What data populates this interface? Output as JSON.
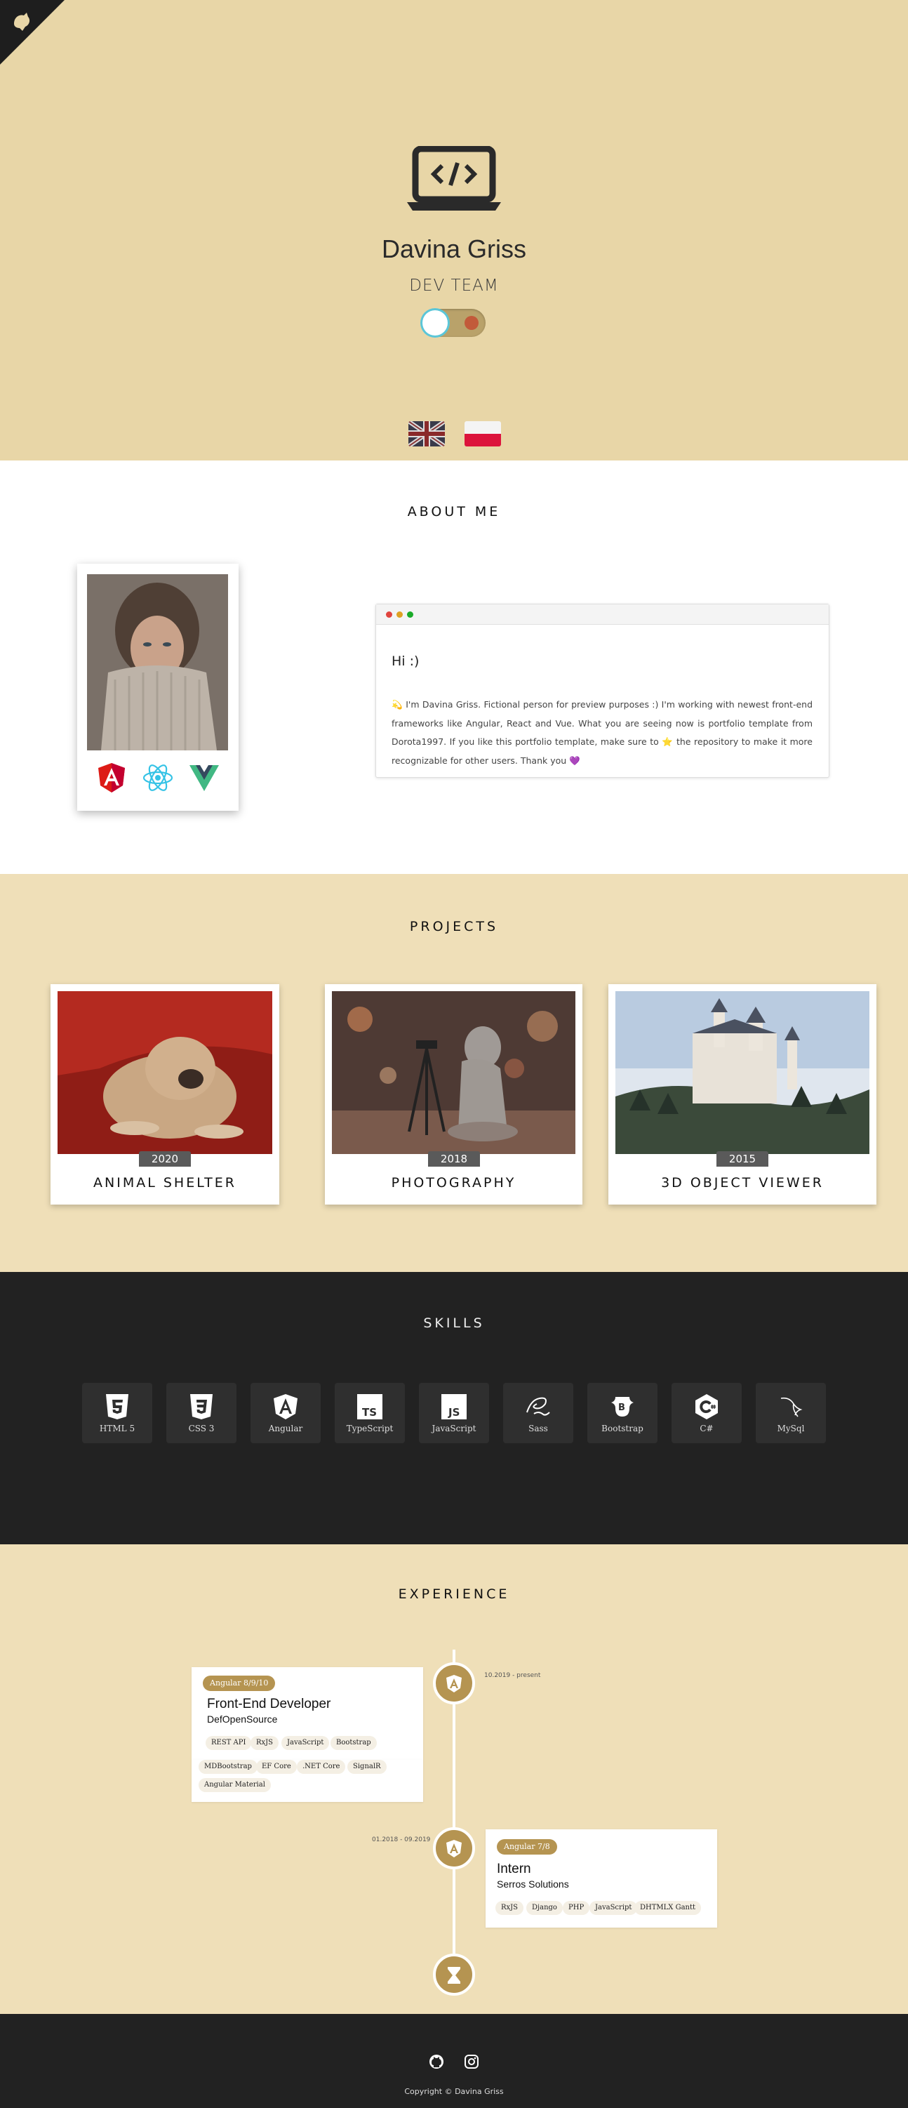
{
  "header": {
    "name": "Davina Griss",
    "role": "DEV TEAM",
    "theme_toggle": "day-night-toggle",
    "languages": [
      {
        "code": "en",
        "icon": "uk-flag-icon"
      },
      {
        "code": "pl",
        "icon": "poland-flag-icon"
      }
    ],
    "colors": {
      "background": "#e8d6a7",
      "accent": "#b59451"
    }
  },
  "about": {
    "title": "ABOUT ME",
    "tech_icons": [
      "angular-icon",
      "react-icon",
      "vue-icon"
    ],
    "greeting": "Hi :)",
    "text_emoji_start": "💫",
    "text_part1": "I'm Davina Griss. Fictional person for preview purposes :) I'm working with newest front-end frameworks like Angular, React and Vue. What you are seeing now is portfolio template from Dorota1997. If you like this portfolio template, make sure to",
    "text_star": "⭐",
    "text_part2": "the repository to make it more recognizable for other users. Thank you",
    "text_heart": "💜"
  },
  "projects": {
    "title": "PROJECTS",
    "items": [
      {
        "name": "ANIMAL SHELTER",
        "year": "2020"
      },
      {
        "name": "PHOTOGRAPHY",
        "year": "2018"
      },
      {
        "name": "3D OBJECT VIEWER",
        "year": "2015"
      }
    ]
  },
  "skills": {
    "title": "SKILLS",
    "items": [
      {
        "label": "HTML 5",
        "icon": "html5-icon"
      },
      {
        "label": "CSS 3",
        "icon": "css3-icon"
      },
      {
        "label": "Angular",
        "icon": "angular-icon"
      },
      {
        "label": "TypeScript",
        "icon": "typescript-icon"
      },
      {
        "label": "JavaScript",
        "icon": "javascript-icon"
      },
      {
        "label": "Sass",
        "icon": "sass-icon"
      },
      {
        "label": "Bootstrap",
        "icon": "bootstrap-icon"
      },
      {
        "label": "C#",
        "icon": "csharp-icon"
      },
      {
        "label": "MySql",
        "icon": "mysql-icon"
      }
    ]
  },
  "experience": {
    "title": "EXPERIENCE",
    "jobs": [
      {
        "badge": "Angular 8/9/10",
        "title": "Front-End Developer",
        "company": "DefOpenSource",
        "date": "10.2019 - present",
        "tags": [
          "REST API",
          "RxJS",
          "JavaScript",
          "Bootstrap",
          "MDBootstrap",
          "EF Core",
          ".NET Core",
          "SignalR",
          "Angular Material"
        ]
      },
      {
        "badge": "Angular 7/8",
        "title": "Intern",
        "company": "Serros Solutions",
        "date": "01.2018 - 09.2019",
        "tags": [
          "RxJS",
          "Django",
          "PHP",
          "JavaScript",
          "DHTMLX Gantt"
        ]
      }
    ]
  },
  "footer": {
    "icons": [
      "github-icon",
      "instagram-icon"
    ],
    "copyright": "Copyright © Davina Griss"
  }
}
